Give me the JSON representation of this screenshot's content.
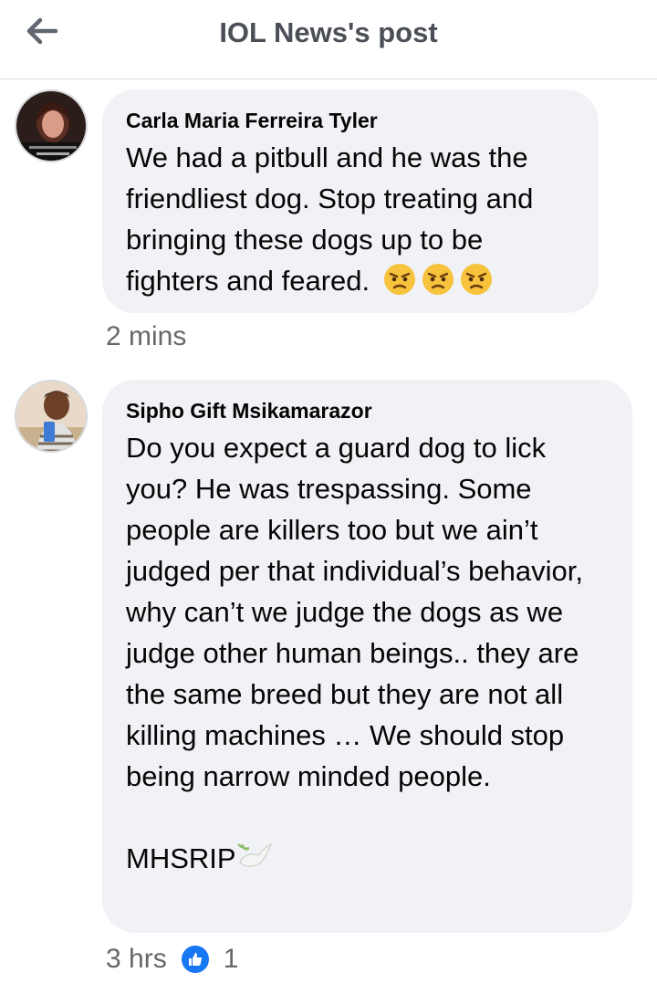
{
  "header": {
    "title": "IOL News's post",
    "back_icon": "arrow-left-icon"
  },
  "comments": [
    {
      "author": "Carla Maria Ferreira Tyler",
      "text": "We had a pitbull and he was the friendliest dog. Stop treating and bringing these dogs up to be fighters and feared.",
      "emojis": [
        "angry-face-icon",
        "angry-face-icon",
        "angry-face-icon"
      ],
      "time": "2 mins"
    },
    {
      "author": "Sipho Gift Msikamarazor",
      "text": "Do you expect a guard dog to lick you? He was trespassing. Some people are killers too but we ain’t judged per that individual’s behavior, why can’t we judge the dogs as we judge other human beings.. they are the same breed but they are not all killing machines … We should stop being narrow minded people.",
      "signoff": "MHSRIP",
      "signoff_icon": "dove-icon",
      "time": "3 hrs",
      "reaction_icon": "like-icon",
      "like_count": "1"
    }
  ],
  "colors": {
    "bubble": "#f0f2f5",
    "meta": "#65676b",
    "like": "#1877f2",
    "header_title": "#4b4f56"
  }
}
